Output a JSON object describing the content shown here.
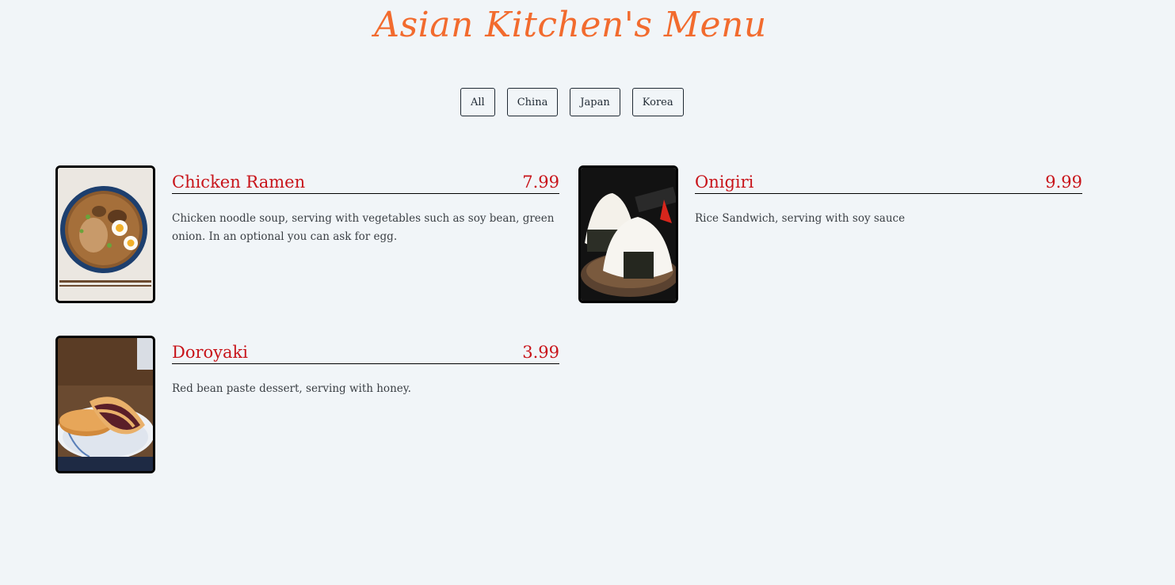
{
  "page": {
    "title": "Asian Kitchen's Menu"
  },
  "filters": [
    "All",
    "China",
    "Japan",
    "Korea"
  ],
  "items": [
    {
      "name": "Chicken Ramen",
      "price": "7.99",
      "description": "Chicken noodle soup, serving with vegetables such as soy bean, green onion. In an optional you can ask for egg.",
      "image": "ramen-bowl"
    },
    {
      "name": "Onigiri",
      "price": "9.99",
      "description": "Rice Sandwich, serving with soy sauce",
      "image": "onigiri"
    },
    {
      "name": "Doroyaki",
      "price": "3.99",
      "description": "Red bean paste dessert, serving with honey.",
      "image": "dorayaki"
    }
  ],
  "colors": {
    "background": "#f1f5f8",
    "title": "#f26b2e",
    "accent": "#c8141a",
    "text": "#3a3f44"
  }
}
